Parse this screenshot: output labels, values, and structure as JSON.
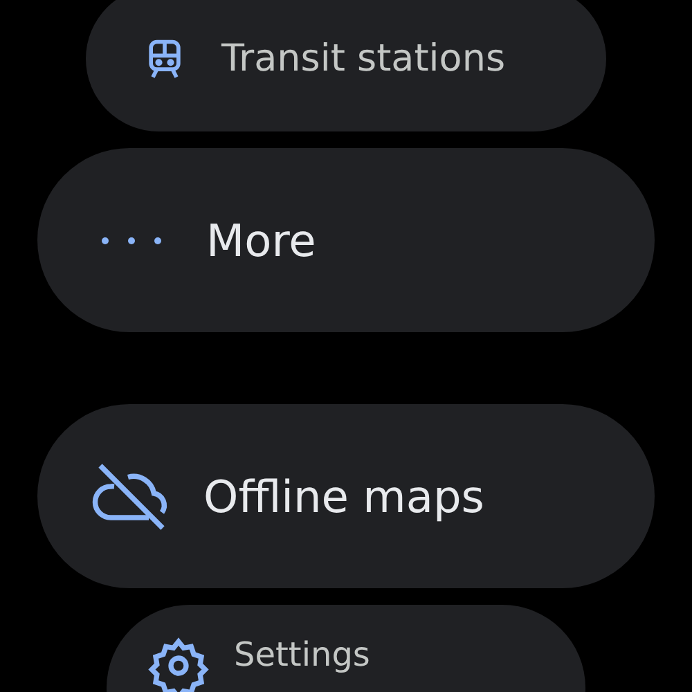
{
  "menu": [
    {
      "label": "Transit stations",
      "kind": "train"
    },
    {
      "label": "More",
      "kind": "more"
    },
    {
      "label": "Offline maps",
      "kind": "offline"
    },
    {
      "label": "Settings",
      "kind": "settings"
    }
  ]
}
